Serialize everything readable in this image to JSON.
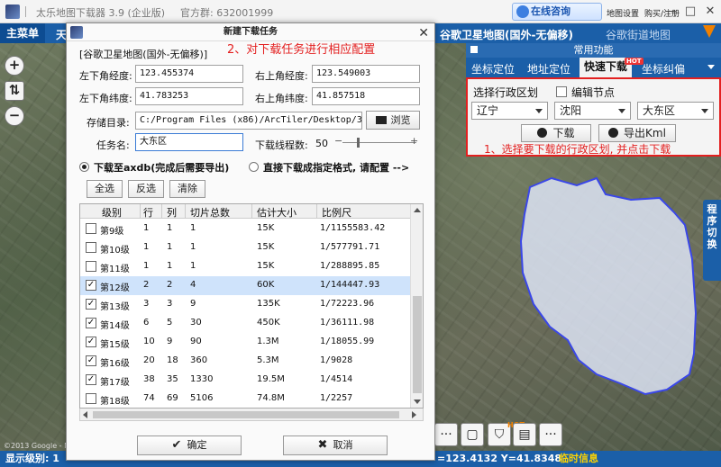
{
  "app": {
    "title": "太乐地图下载器 3.9 (企业版)",
    "group": "官方群: 632001999",
    "online_consult": "在线咨询",
    "map_settings": "地图设置",
    "buy_register": "购买/注册",
    "window_min": "—",
    "window_max": "□",
    "window_close": "✕"
  },
  "toolbar": {
    "main_menu": "主菜单",
    "peek_char": "天",
    "google_sat": "谷歌卫星地图(国外-无偏移)",
    "google_street": "谷歌街道地图"
  },
  "map_controls": {
    "zoom_in": "+",
    "swap": "⇅",
    "zoom_out": "−"
  },
  "side_tab": {
    "label": "程序切换"
  },
  "bottom_tools": {
    "more": "···",
    "hot": "HOT"
  },
  "status": {
    "level": "显示级别: 1",
    "coords": "=123.4132 Y=41.8348",
    "temp_info": "临时信息"
  },
  "copyright": "©2013 Google - Ma",
  "right_panel": {
    "header": "常用功能",
    "tabs": [
      "坐标定位",
      "地址定位",
      "快速下载",
      "坐标纠偏"
    ],
    "hot": "HOT",
    "region_label": "选择行政区划",
    "edit_nodes": "编辑节点",
    "province": "辽宁",
    "city": "沈阳",
    "district": "大东区",
    "download_btn": "下载",
    "export_kml": "导出Kml",
    "note": "1、选择要下载的行政区划, 并点击下载"
  },
  "dialog": {
    "title": "新建下载任务",
    "close": "✕",
    "source": "[谷歌卫星地图(国外-无偏移)]",
    "note": "2、对下载任务进行相应配置",
    "lon_lb_label": "左下角经度:",
    "lon_lb_value": "123.455374",
    "lon_rt_label": "右上角经度:",
    "lon_rt_value": "123.549003",
    "lat_lb_label": "左下角纬度:",
    "lat_lb_value": "41.783253",
    "lat_rt_label": "右上角纬度:",
    "lat_rt_value": "41.857518",
    "dir_label": "存储目录:",
    "dir_value": "C:/Program Files (x86)/ArcTiler/Desktop/3.9/D:",
    "browse": "浏览",
    "task_label": "任务名:",
    "task_value": "大东区",
    "threads_label": "下载线程数:",
    "threads_value": "50",
    "slider_minus": "−",
    "slider_plus": "+",
    "radio_axdb": "下载至axdb(完成后需要导出)",
    "radio_direct": "直接下载成指定格式, 请配置 -->",
    "select_all": "全选",
    "invert": "反选",
    "clear": "清除",
    "columns": [
      "级别",
      "行",
      "列",
      "切片总数",
      "估计大小",
      "比例尺"
    ],
    "rows": [
      {
        "checked": "",
        "level": "第9级",
        "row": "1",
        "col": "1",
        "tiles": "1",
        "size": "15K",
        "scale": "1/1155583.42"
      },
      {
        "checked": "",
        "level": "第10级",
        "row": "1",
        "col": "1",
        "tiles": "1",
        "size": "15K",
        "scale": "1/577791.71"
      },
      {
        "checked": "",
        "level": "第11级",
        "row": "1",
        "col": "1",
        "tiles": "1",
        "size": "15K",
        "scale": "1/288895.85"
      },
      {
        "checked": "✓",
        "level": "第12级",
        "row": "2",
        "col": "2",
        "tiles": "4",
        "size": "60K",
        "scale": "1/144447.93"
      },
      {
        "checked": "✓",
        "level": "第13级",
        "row": "3",
        "col": "3",
        "tiles": "9",
        "size": "135K",
        "scale": "1/72223.96"
      },
      {
        "checked": "✓",
        "level": "第14级",
        "row": "6",
        "col": "5",
        "tiles": "30",
        "size": "450K",
        "scale": "1/36111.98"
      },
      {
        "checked": "✓",
        "level": "第15级",
        "row": "10",
        "col": "9",
        "tiles": "90",
        "size": "1.3M",
        "scale": "1/18055.99"
      },
      {
        "checked": "✓",
        "level": "第16级",
        "row": "20",
        "col": "18",
        "tiles": "360",
        "size": "5.3M",
        "scale": "1/9028"
      },
      {
        "checked": "✓",
        "level": "第17级",
        "row": "38",
        "col": "35",
        "tiles": "1330",
        "size": "19.5M",
        "scale": "1/4514"
      },
      {
        "checked": "",
        "level": "第18级",
        "row": "74",
        "col": "69",
        "tiles": "5106",
        "size": "74.8M",
        "scale": "1/2257"
      }
    ],
    "confirm": "确定",
    "cancel": "取消"
  }
}
